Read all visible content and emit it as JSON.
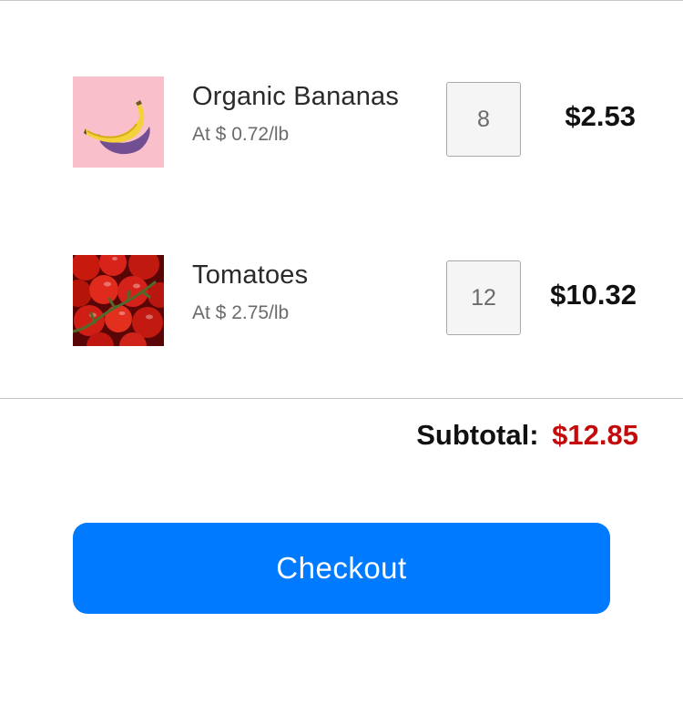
{
  "cart": {
    "items": [
      {
        "name": "Organic Bananas",
        "rate": "At $ 0.72/lb",
        "quantity": "8",
        "price": "$2.53",
        "image": "banana-image"
      },
      {
        "name": "Tomatoes",
        "rate": "At $ 2.75/lb",
        "quantity": "12",
        "price": "$10.32",
        "image": "tomatoes-image"
      }
    ]
  },
  "summary": {
    "subtotal_label": "Subtotal:",
    "subtotal_value": "$12.85"
  },
  "actions": {
    "checkout_label": "Checkout"
  },
  "colors": {
    "accent": "#007aff",
    "subtotal": "#c30b0b",
    "banana_background": "#f9bfca"
  }
}
